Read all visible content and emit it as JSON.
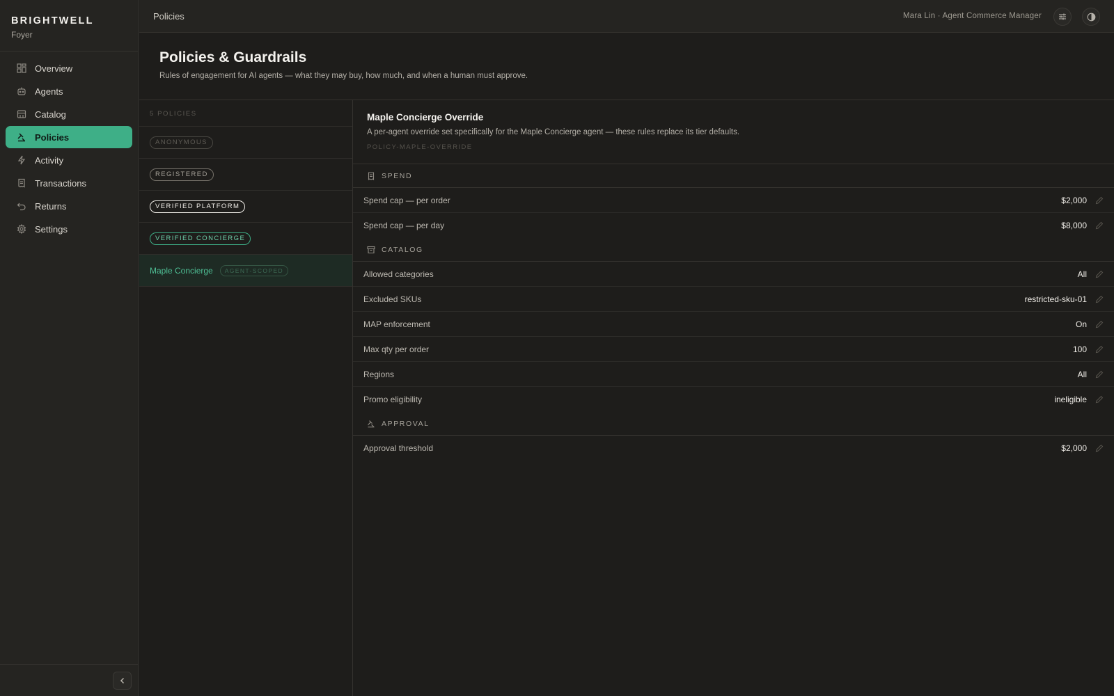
{
  "brand": {
    "name": "BRIGHTWELL",
    "sub": "Foyer"
  },
  "nav": {
    "items": [
      {
        "label": "Overview",
        "icon": "dashboard-icon"
      },
      {
        "label": "Agents",
        "icon": "bot-icon"
      },
      {
        "label": "Catalog",
        "icon": "store-icon"
      },
      {
        "label": "Policies",
        "icon": "gavel-icon",
        "active": true
      },
      {
        "label": "Activity",
        "icon": "bolt-icon"
      },
      {
        "label": "Transactions",
        "icon": "receipt-icon"
      },
      {
        "label": "Returns",
        "icon": "undo-icon"
      },
      {
        "label": "Settings",
        "icon": "gear-icon"
      }
    ]
  },
  "topbar": {
    "breadcrumb": "Policies",
    "user": "Mara Lin · Agent Commerce Manager"
  },
  "header": {
    "title": "Policies & Guardrails",
    "description": "Rules of engagement for AI agents — what they may buy, how much, and when a human must approve."
  },
  "policy_list": {
    "count_label": "5 POLICIES",
    "items": [
      {
        "pill": "ANONYMOUS"
      },
      {
        "pill": "REGISTERED"
      },
      {
        "pill": "VERIFIED PLATFORM"
      },
      {
        "pill": "VERIFIED CONCIERGE"
      },
      {
        "name": "Maple Concierge",
        "pill": "AGENT-SCOPED",
        "active": true
      }
    ]
  },
  "detail": {
    "title": "Maple Concierge Override",
    "description": "A per-agent override set specifically for the Maple Concierge agent — these rules replace its tier defaults.",
    "id": "POLICY-MAPLE-OVERRIDE",
    "sections": {
      "spend": {
        "title": "SPEND",
        "rows": [
          {
            "label": "Spend cap — per order",
            "value": "$2,000"
          },
          {
            "label": "Spend cap — per day",
            "value": "$8,000"
          }
        ]
      },
      "catalog": {
        "title": "CATALOG",
        "rows": [
          {
            "label": "Allowed categories",
            "value": "All"
          },
          {
            "label": "Excluded SKUs",
            "value": "restricted-sku-01"
          },
          {
            "label": "MAP enforcement",
            "value": "On"
          },
          {
            "label": "Max qty per order",
            "value": "100"
          },
          {
            "label": "Regions",
            "value": "All"
          },
          {
            "label": "Promo eligibility",
            "value": "ineligible"
          }
        ]
      },
      "approval": {
        "title": "APPROVAL",
        "rows": [
          {
            "label": "Approval threshold",
            "value": "$2,000"
          }
        ]
      }
    }
  },
  "colors": {
    "accent": "#3eaf87",
    "background": "#1e1d1b",
    "sidebar": "#252421"
  }
}
